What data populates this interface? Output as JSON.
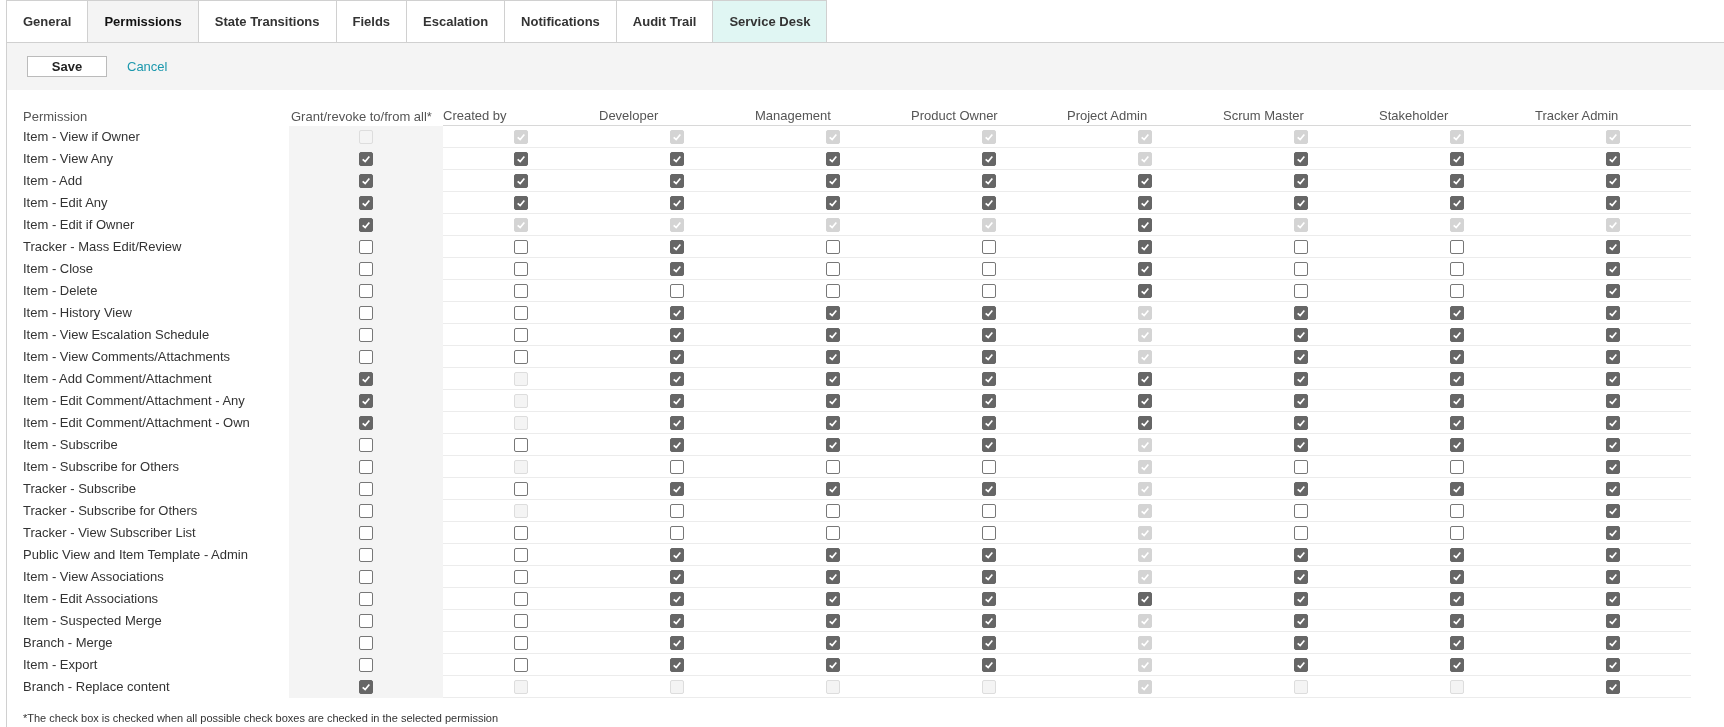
{
  "tabs": [
    {
      "label": "General",
      "selected": false,
      "highlighted": false
    },
    {
      "label": "Permissions",
      "selected": true,
      "highlighted": false
    },
    {
      "label": "State Transitions",
      "selected": false,
      "highlighted": false
    },
    {
      "label": "Fields",
      "selected": false,
      "highlighted": false
    },
    {
      "label": "Escalation",
      "selected": false,
      "highlighted": false
    },
    {
      "label": "Notifications",
      "selected": false,
      "highlighted": false
    },
    {
      "label": "Audit Trail",
      "selected": false,
      "highlighted": false
    },
    {
      "label": "Service Desk",
      "selected": false,
      "highlighted": true
    }
  ],
  "toolbar": {
    "save": "Save",
    "cancel": "Cancel"
  },
  "table": {
    "columns": [
      "Permission",
      "Grant/revoke to/from all*",
      "Created by",
      "Developer",
      "Management",
      "Product Owner",
      "Project Admin",
      "Scrum Master",
      "Stakeholder",
      "Tracker Admin"
    ],
    "rows": [
      {
        "label": "Item - View if Owner",
        "cells": [
          {
            "checked": false,
            "disabled": true
          },
          {
            "checked": true,
            "disabled": true
          },
          {
            "checked": true,
            "disabled": true
          },
          {
            "checked": true,
            "disabled": true
          },
          {
            "checked": true,
            "disabled": true
          },
          {
            "checked": true,
            "disabled": true
          },
          {
            "checked": true,
            "disabled": true
          },
          {
            "checked": true,
            "disabled": true
          },
          {
            "checked": true,
            "disabled": true
          }
        ]
      },
      {
        "label": "Item - View Any",
        "cells": [
          {
            "checked": true,
            "disabled": false
          },
          {
            "checked": true,
            "disabled": false
          },
          {
            "checked": true,
            "disabled": false
          },
          {
            "checked": true,
            "disabled": false
          },
          {
            "checked": true,
            "disabled": false
          },
          {
            "checked": true,
            "disabled": true
          },
          {
            "checked": true,
            "disabled": false
          },
          {
            "checked": true,
            "disabled": false
          },
          {
            "checked": true,
            "disabled": false
          }
        ]
      },
      {
        "label": "Item - Add",
        "cells": [
          {
            "checked": true,
            "disabled": false
          },
          {
            "checked": true,
            "disabled": false
          },
          {
            "checked": true,
            "disabled": false
          },
          {
            "checked": true,
            "disabled": false
          },
          {
            "checked": true,
            "disabled": false
          },
          {
            "checked": true,
            "disabled": false
          },
          {
            "checked": true,
            "disabled": false
          },
          {
            "checked": true,
            "disabled": false
          },
          {
            "checked": true,
            "disabled": false
          }
        ]
      },
      {
        "label": "Item - Edit Any",
        "cells": [
          {
            "checked": true,
            "disabled": false
          },
          {
            "checked": true,
            "disabled": false
          },
          {
            "checked": true,
            "disabled": false
          },
          {
            "checked": true,
            "disabled": false
          },
          {
            "checked": true,
            "disabled": false
          },
          {
            "checked": true,
            "disabled": false
          },
          {
            "checked": true,
            "disabled": false
          },
          {
            "checked": true,
            "disabled": false
          },
          {
            "checked": true,
            "disabled": false
          }
        ]
      },
      {
        "label": "Item - Edit if Owner",
        "cells": [
          {
            "checked": true,
            "disabled": false
          },
          {
            "checked": true,
            "disabled": true
          },
          {
            "checked": true,
            "disabled": true
          },
          {
            "checked": true,
            "disabled": true
          },
          {
            "checked": true,
            "disabled": true
          },
          {
            "checked": true,
            "disabled": false
          },
          {
            "checked": true,
            "disabled": true
          },
          {
            "checked": true,
            "disabled": true
          },
          {
            "checked": true,
            "disabled": true
          }
        ]
      },
      {
        "label": "Tracker - Mass Edit/Review",
        "cells": [
          {
            "checked": false,
            "disabled": false
          },
          {
            "checked": false,
            "disabled": false
          },
          {
            "checked": true,
            "disabled": false
          },
          {
            "checked": false,
            "disabled": false
          },
          {
            "checked": false,
            "disabled": false
          },
          {
            "checked": true,
            "disabled": false
          },
          {
            "checked": false,
            "disabled": false
          },
          {
            "checked": false,
            "disabled": false
          },
          {
            "checked": true,
            "disabled": false
          }
        ]
      },
      {
        "label": "Item - Close",
        "cells": [
          {
            "checked": false,
            "disabled": false
          },
          {
            "checked": false,
            "disabled": false
          },
          {
            "checked": true,
            "disabled": false
          },
          {
            "checked": false,
            "disabled": false
          },
          {
            "checked": false,
            "disabled": false
          },
          {
            "checked": true,
            "disabled": false
          },
          {
            "checked": false,
            "disabled": false
          },
          {
            "checked": false,
            "disabled": false
          },
          {
            "checked": true,
            "disabled": false
          }
        ]
      },
      {
        "label": "Item - Delete",
        "cells": [
          {
            "checked": false,
            "disabled": false
          },
          {
            "checked": false,
            "disabled": false
          },
          {
            "checked": false,
            "disabled": false
          },
          {
            "checked": false,
            "disabled": false
          },
          {
            "checked": false,
            "disabled": false
          },
          {
            "checked": true,
            "disabled": false
          },
          {
            "checked": false,
            "disabled": false
          },
          {
            "checked": false,
            "disabled": false
          },
          {
            "checked": true,
            "disabled": false
          }
        ]
      },
      {
        "label": "Item - History View",
        "cells": [
          {
            "checked": false,
            "disabled": false
          },
          {
            "checked": false,
            "disabled": false
          },
          {
            "checked": true,
            "disabled": false
          },
          {
            "checked": true,
            "disabled": false
          },
          {
            "checked": true,
            "disabled": false
          },
          {
            "checked": true,
            "disabled": true
          },
          {
            "checked": true,
            "disabled": false
          },
          {
            "checked": true,
            "disabled": false
          },
          {
            "checked": true,
            "disabled": false
          }
        ]
      },
      {
        "label": "Item - View Escalation Schedule",
        "cells": [
          {
            "checked": false,
            "disabled": false
          },
          {
            "checked": false,
            "disabled": false
          },
          {
            "checked": true,
            "disabled": false
          },
          {
            "checked": true,
            "disabled": false
          },
          {
            "checked": true,
            "disabled": false
          },
          {
            "checked": true,
            "disabled": true
          },
          {
            "checked": true,
            "disabled": false
          },
          {
            "checked": true,
            "disabled": false
          },
          {
            "checked": true,
            "disabled": false
          }
        ]
      },
      {
        "label": "Item - View Comments/Attachments",
        "cells": [
          {
            "checked": false,
            "disabled": false
          },
          {
            "checked": false,
            "disabled": false
          },
          {
            "checked": true,
            "disabled": false
          },
          {
            "checked": true,
            "disabled": false
          },
          {
            "checked": true,
            "disabled": false
          },
          {
            "checked": true,
            "disabled": true
          },
          {
            "checked": true,
            "disabled": false
          },
          {
            "checked": true,
            "disabled": false
          },
          {
            "checked": true,
            "disabled": false
          }
        ]
      },
      {
        "label": "Item - Add Comment/Attachment",
        "cells": [
          {
            "checked": true,
            "disabled": false
          },
          {
            "checked": false,
            "disabled": true
          },
          {
            "checked": true,
            "disabled": false
          },
          {
            "checked": true,
            "disabled": false
          },
          {
            "checked": true,
            "disabled": false
          },
          {
            "checked": true,
            "disabled": false
          },
          {
            "checked": true,
            "disabled": false
          },
          {
            "checked": true,
            "disabled": false
          },
          {
            "checked": true,
            "disabled": false
          }
        ]
      },
      {
        "label": "Item - Edit Comment/Attachment - Any",
        "cells": [
          {
            "checked": true,
            "disabled": false
          },
          {
            "checked": false,
            "disabled": true
          },
          {
            "checked": true,
            "disabled": false
          },
          {
            "checked": true,
            "disabled": false
          },
          {
            "checked": true,
            "disabled": false
          },
          {
            "checked": true,
            "disabled": false
          },
          {
            "checked": true,
            "disabled": false
          },
          {
            "checked": true,
            "disabled": false
          },
          {
            "checked": true,
            "disabled": false
          }
        ]
      },
      {
        "label": "Item - Edit Comment/Attachment - Own",
        "cells": [
          {
            "checked": true,
            "disabled": false
          },
          {
            "checked": false,
            "disabled": true
          },
          {
            "checked": true,
            "disabled": false
          },
          {
            "checked": true,
            "disabled": false
          },
          {
            "checked": true,
            "disabled": false
          },
          {
            "checked": true,
            "disabled": false
          },
          {
            "checked": true,
            "disabled": false
          },
          {
            "checked": true,
            "disabled": false
          },
          {
            "checked": true,
            "disabled": false
          }
        ]
      },
      {
        "label": "Item - Subscribe",
        "cells": [
          {
            "checked": false,
            "disabled": false
          },
          {
            "checked": false,
            "disabled": false
          },
          {
            "checked": true,
            "disabled": false
          },
          {
            "checked": true,
            "disabled": false
          },
          {
            "checked": true,
            "disabled": false
          },
          {
            "checked": true,
            "disabled": true
          },
          {
            "checked": true,
            "disabled": false
          },
          {
            "checked": true,
            "disabled": false
          },
          {
            "checked": true,
            "disabled": false
          }
        ]
      },
      {
        "label": "Item - Subscribe for Others",
        "cells": [
          {
            "checked": false,
            "disabled": false
          },
          {
            "checked": false,
            "disabled": true
          },
          {
            "checked": false,
            "disabled": false
          },
          {
            "checked": false,
            "disabled": false
          },
          {
            "checked": false,
            "disabled": false
          },
          {
            "checked": true,
            "disabled": true
          },
          {
            "checked": false,
            "disabled": false
          },
          {
            "checked": false,
            "disabled": false
          },
          {
            "checked": true,
            "disabled": false
          }
        ]
      },
      {
        "label": "Tracker - Subscribe",
        "cells": [
          {
            "checked": false,
            "disabled": false
          },
          {
            "checked": false,
            "disabled": false
          },
          {
            "checked": true,
            "disabled": false
          },
          {
            "checked": true,
            "disabled": false
          },
          {
            "checked": true,
            "disabled": false
          },
          {
            "checked": true,
            "disabled": true
          },
          {
            "checked": true,
            "disabled": false
          },
          {
            "checked": true,
            "disabled": false
          },
          {
            "checked": true,
            "disabled": false
          }
        ]
      },
      {
        "label": "Tracker - Subscribe for Others",
        "cells": [
          {
            "checked": false,
            "disabled": false
          },
          {
            "checked": false,
            "disabled": true
          },
          {
            "checked": false,
            "disabled": false
          },
          {
            "checked": false,
            "disabled": false
          },
          {
            "checked": false,
            "disabled": false
          },
          {
            "checked": true,
            "disabled": true
          },
          {
            "checked": false,
            "disabled": false
          },
          {
            "checked": false,
            "disabled": false
          },
          {
            "checked": true,
            "disabled": false
          }
        ]
      },
      {
        "label": "Tracker - View Subscriber List",
        "cells": [
          {
            "checked": false,
            "disabled": false
          },
          {
            "checked": false,
            "disabled": false
          },
          {
            "checked": false,
            "disabled": false
          },
          {
            "checked": false,
            "disabled": false
          },
          {
            "checked": false,
            "disabled": false
          },
          {
            "checked": true,
            "disabled": true
          },
          {
            "checked": false,
            "disabled": false
          },
          {
            "checked": false,
            "disabled": false
          },
          {
            "checked": true,
            "disabled": false
          }
        ]
      },
      {
        "label": "Public View and Item Template - Admin",
        "cells": [
          {
            "checked": false,
            "disabled": false
          },
          {
            "checked": false,
            "disabled": false
          },
          {
            "checked": true,
            "disabled": false
          },
          {
            "checked": true,
            "disabled": false
          },
          {
            "checked": true,
            "disabled": false
          },
          {
            "checked": true,
            "disabled": true
          },
          {
            "checked": true,
            "disabled": false
          },
          {
            "checked": true,
            "disabled": false
          },
          {
            "checked": true,
            "disabled": false
          }
        ]
      },
      {
        "label": "Item - View Associations",
        "cells": [
          {
            "checked": false,
            "disabled": false
          },
          {
            "checked": false,
            "disabled": false
          },
          {
            "checked": true,
            "disabled": false
          },
          {
            "checked": true,
            "disabled": false
          },
          {
            "checked": true,
            "disabled": false
          },
          {
            "checked": true,
            "disabled": true
          },
          {
            "checked": true,
            "disabled": false
          },
          {
            "checked": true,
            "disabled": false
          },
          {
            "checked": true,
            "disabled": false
          }
        ]
      },
      {
        "label": "Item - Edit Associations",
        "cells": [
          {
            "checked": false,
            "disabled": false
          },
          {
            "checked": false,
            "disabled": false
          },
          {
            "checked": true,
            "disabled": false
          },
          {
            "checked": true,
            "disabled": false
          },
          {
            "checked": true,
            "disabled": false
          },
          {
            "checked": true,
            "disabled": false
          },
          {
            "checked": true,
            "disabled": false
          },
          {
            "checked": true,
            "disabled": false
          },
          {
            "checked": true,
            "disabled": false
          }
        ]
      },
      {
        "label": "Item - Suspected Merge",
        "cells": [
          {
            "checked": false,
            "disabled": false
          },
          {
            "checked": false,
            "disabled": false
          },
          {
            "checked": true,
            "disabled": false
          },
          {
            "checked": true,
            "disabled": false
          },
          {
            "checked": true,
            "disabled": false
          },
          {
            "checked": true,
            "disabled": true
          },
          {
            "checked": true,
            "disabled": false
          },
          {
            "checked": true,
            "disabled": false
          },
          {
            "checked": true,
            "disabled": false
          }
        ]
      },
      {
        "label": "Branch - Merge",
        "cells": [
          {
            "checked": false,
            "disabled": false
          },
          {
            "checked": false,
            "disabled": false
          },
          {
            "checked": true,
            "disabled": false
          },
          {
            "checked": true,
            "disabled": false
          },
          {
            "checked": true,
            "disabled": false
          },
          {
            "checked": true,
            "disabled": true
          },
          {
            "checked": true,
            "disabled": false
          },
          {
            "checked": true,
            "disabled": false
          },
          {
            "checked": true,
            "disabled": false
          }
        ]
      },
      {
        "label": "Item - Export",
        "cells": [
          {
            "checked": false,
            "disabled": false
          },
          {
            "checked": false,
            "disabled": false
          },
          {
            "checked": true,
            "disabled": false
          },
          {
            "checked": true,
            "disabled": false
          },
          {
            "checked": true,
            "disabled": false
          },
          {
            "checked": true,
            "disabled": true
          },
          {
            "checked": true,
            "disabled": false
          },
          {
            "checked": true,
            "disabled": false
          },
          {
            "checked": true,
            "disabled": false
          }
        ]
      },
      {
        "label": "Branch - Replace content",
        "cells": [
          {
            "checked": true,
            "disabled": false
          },
          {
            "checked": false,
            "disabled": true
          },
          {
            "checked": false,
            "disabled": true
          },
          {
            "checked": false,
            "disabled": true
          },
          {
            "checked": false,
            "disabled": true
          },
          {
            "checked": true,
            "disabled": true
          },
          {
            "checked": false,
            "disabled": true
          },
          {
            "checked": false,
            "disabled": true
          },
          {
            "checked": true,
            "disabled": false
          }
        ]
      }
    ]
  },
  "footnote": "*The check box is checked when all possible check boxes are checked in the selected permission"
}
